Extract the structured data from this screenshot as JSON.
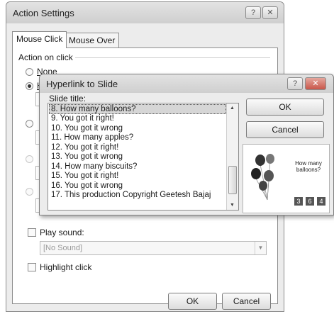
{
  "outer_dialog": {
    "title": "Action Settings",
    "help_btn": "?",
    "close_btn": "✕",
    "tabs": [
      {
        "label": "Mouse Click"
      },
      {
        "label": "Mouse Over"
      }
    ],
    "action_group_label": "Action on click",
    "radio_none": "None",
    "radio_hyperlink": "H",
    "play_sound_label": "Play sound:",
    "sound_value": "[No Sound]",
    "highlight_label": "Highlight click",
    "ok": "OK",
    "cancel": "Cancel"
  },
  "inner_dialog": {
    "title": "Hyperlink to Slide",
    "help_btn": "?",
    "close_btn": "✕",
    "list_label": "Slide title:",
    "slides": [
      "8. How many balloons?",
      "9. You got it right!",
      "10. You got it wrong",
      "11. How many apples?",
      "12. You got it right!",
      "13. You got it wrong",
      "14. How many biscuits?",
      "15. You got it right!",
      "16. You got it wrong",
      "17. This production Copyright Geetesh Bajaj"
    ],
    "selected_index": 0,
    "ok": "OK",
    "cancel": "Cancel",
    "preview": {
      "caption_line1": "How many",
      "caption_line2": "balloons?",
      "choices": [
        "3",
        "6",
        "4"
      ]
    }
  }
}
